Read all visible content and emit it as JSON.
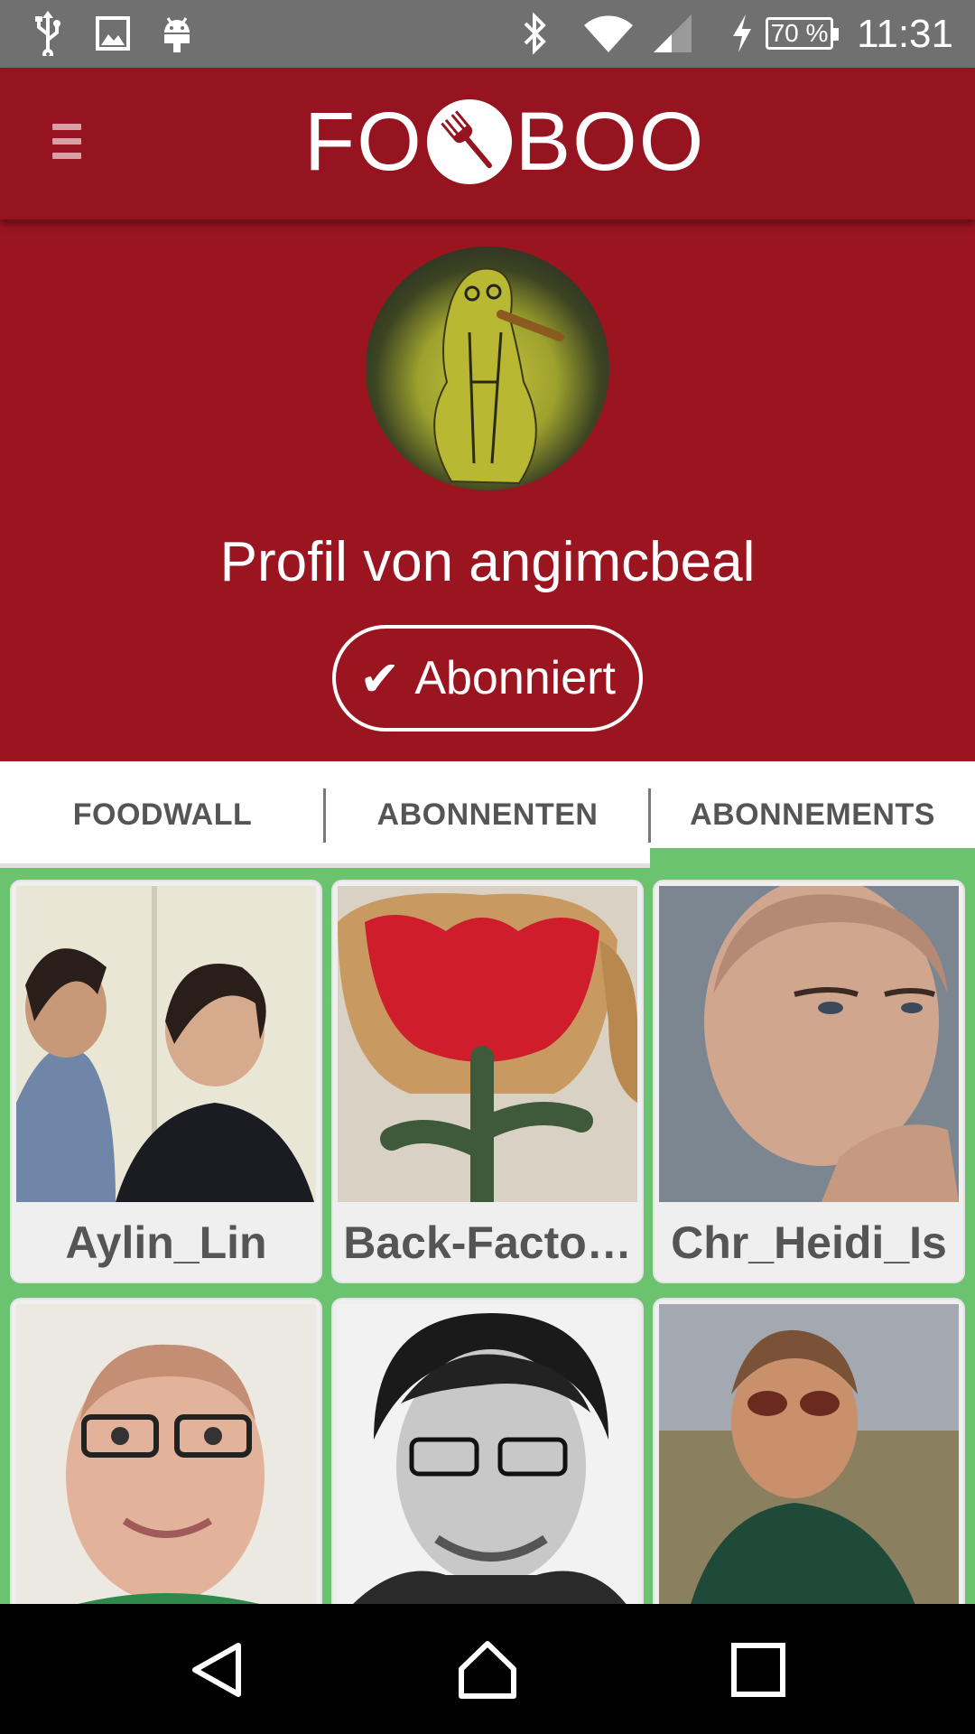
{
  "status_bar": {
    "time": "11:31",
    "battery": "70 %",
    "icons": [
      "usb-icon",
      "image-icon",
      "android-icon",
      "bluetooth-icon",
      "wifi-icon",
      "cell-signal-icon",
      "charging-icon",
      "battery-icon"
    ]
  },
  "app_bar": {
    "logo_left": "FO",
    "logo_right": "BOO",
    "menu_icon": "hamburger-menu-icon"
  },
  "profile": {
    "title": "Profil von angimcbeal",
    "subscribe_button": "Abonniert",
    "subscribe_check": "✔"
  },
  "tabs": [
    {
      "label": "FOODWALL",
      "active": false
    },
    {
      "label": "ABONNENTEN",
      "active": false
    },
    {
      "label": "ABONNEMENTS",
      "active": true
    }
  ],
  "subscriptions": [
    {
      "name": "Aylin_Lin"
    },
    {
      "name": "Back-Factory"
    },
    {
      "name": "Chr_Heidi_Is"
    },
    {
      "name": ""
    },
    {
      "name": ""
    },
    {
      "name": ""
    }
  ],
  "colors": {
    "app_bar": "#961420",
    "profile_bg": "#9a1520",
    "accent_green": "#6cc36f",
    "status_bar": "#707070",
    "nav_bar": "#000000"
  },
  "nav_bar": {
    "icons": [
      "back-icon",
      "home-icon",
      "recents-icon"
    ]
  }
}
